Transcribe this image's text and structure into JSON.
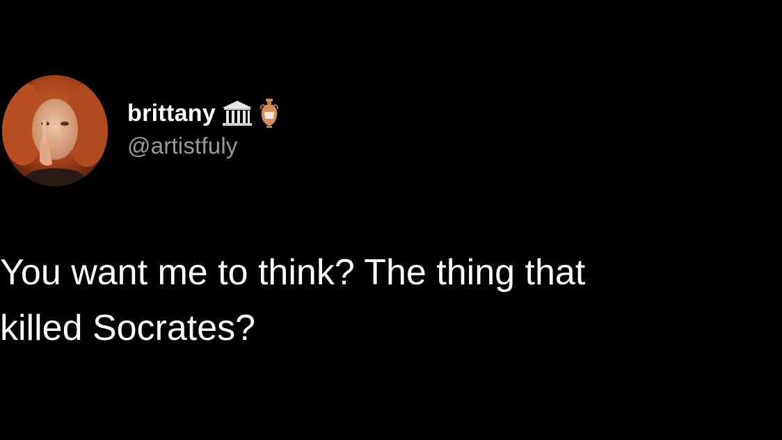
{
  "tweet": {
    "author": {
      "display_name": "brittany",
      "handle": "@artistfuly",
      "name_emojis": [
        "classical-building-icon",
        "amphora-icon"
      ]
    },
    "text": "You want me to think? The thing that\nkilled Socrates?"
  },
  "colors": {
    "background": "#000000",
    "text": "#ffffff",
    "handle": "#9a9a9a"
  }
}
